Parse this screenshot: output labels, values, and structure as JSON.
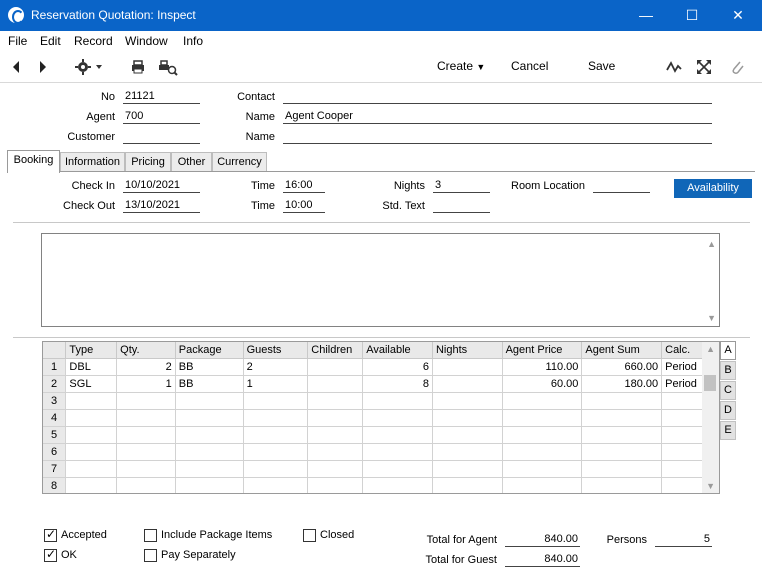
{
  "window": {
    "title": "Reservation Quotation: Inspect"
  },
  "menu": [
    "File",
    "Edit",
    "Record",
    "Window",
    "Info"
  ],
  "toolbar": {
    "create": "Create",
    "cancel": "Cancel",
    "save": "Save"
  },
  "header": {
    "no_label": "No",
    "no": "21121",
    "agent_label": "Agent",
    "agent": "700",
    "customer_label": "Customer",
    "customer": "",
    "contact_label": "Contact",
    "contact": "",
    "name_label": "Name",
    "agent_name": "Agent Cooper",
    "name2_label": "Name",
    "customer_name": ""
  },
  "tabs": [
    "Booking",
    "Information",
    "Pricing",
    "Other",
    "Currency"
  ],
  "booking": {
    "checkin_label": "Check In",
    "checkin": "10/10/2021",
    "checkout_label": "Check Out",
    "checkout": "13/10/2021",
    "time_label": "Time",
    "time_in": "16:00",
    "time2_label": "Time",
    "time_out": "10:00",
    "nights_label": "Nights",
    "nights": "3",
    "stdtext_label": "Std. Text",
    "stdtext": "",
    "room_location_label": "Room Location",
    "room_location": "",
    "availability": "Availability"
  },
  "grid": {
    "headers": [
      "Type",
      "Qty.",
      "Package",
      "Guests",
      "Children",
      "Available",
      "Nights",
      "Agent Price",
      "Agent Sum",
      "Calc."
    ],
    "rows": [
      [
        "1",
        "DBL",
        "2",
        "BB",
        "2",
        "",
        "6",
        "",
        "110.00",
        "660.00",
        "Period"
      ],
      [
        "2",
        "SGL",
        "1",
        "BB",
        "1",
        "",
        "8",
        "",
        "60.00",
        "180.00",
        "Period"
      ],
      [
        "3",
        "",
        "",
        "",
        "",
        "",
        "",
        "",
        "",
        "",
        ""
      ],
      [
        "4",
        "",
        "",
        "",
        "",
        "",
        "",
        "",
        "",
        "",
        ""
      ],
      [
        "5",
        "",
        "",
        "",
        "",
        "",
        "",
        "",
        "",
        "",
        ""
      ],
      [
        "6",
        "",
        "",
        "",
        "",
        "",
        "",
        "",
        "",
        "",
        ""
      ],
      [
        "7",
        "",
        "",
        "",
        "",
        "",
        "",
        "",
        "",
        "",
        ""
      ],
      [
        "8",
        "",
        "",
        "",
        "",
        "",
        "",
        "",
        "",
        "",
        ""
      ]
    ],
    "side_letters": [
      "A",
      "B",
      "C",
      "D",
      "E"
    ]
  },
  "footer": {
    "accepted": "Accepted",
    "accepted_checked": true,
    "ok": "OK",
    "ok_checked": true,
    "include_pkg": "Include Package Items",
    "include_pkg_checked": false,
    "pay_sep": "Pay Separately",
    "pay_sep_checked": false,
    "closed": "Closed",
    "closed_checked": false,
    "total_agent_label": "Total for Agent",
    "total_agent": "840.00",
    "total_guest_label": "Total for Guest",
    "total_guest": "840.00",
    "persons_label": "Persons",
    "persons": "5"
  }
}
